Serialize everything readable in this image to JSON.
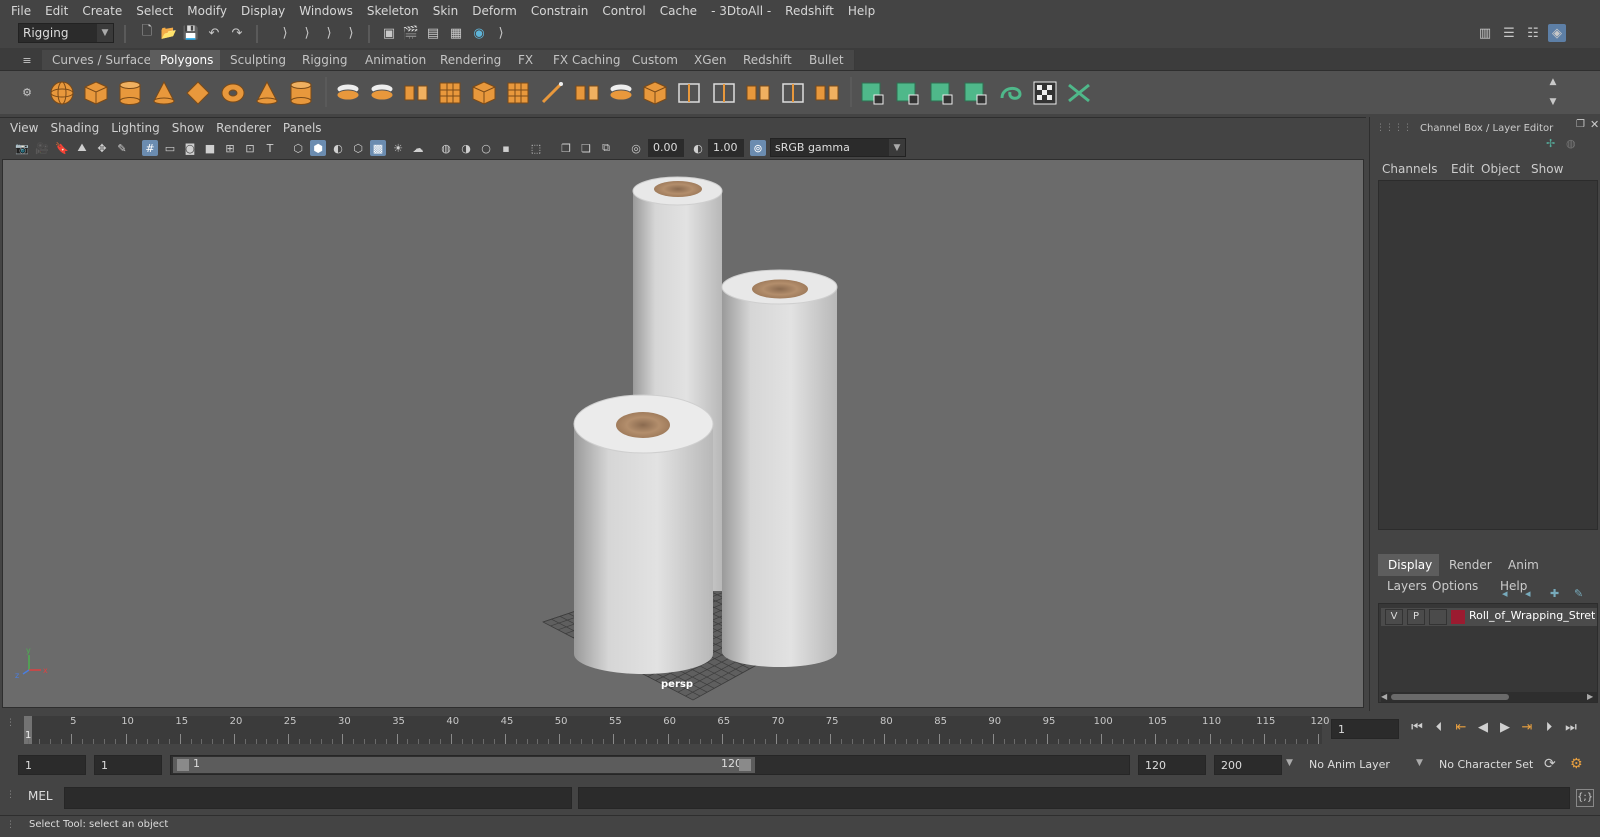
{
  "menubar": [
    "File",
    "Edit",
    "Create",
    "Select",
    "Modify",
    "Display",
    "Windows",
    "Skeleton",
    "Skin",
    "Deform",
    "Constrain",
    "Control",
    "Cache",
    "- 3DtoAll -",
    "Redshift",
    "Help"
  ],
  "statusline": {
    "workspace": "Rigging"
  },
  "shelf_tabs": [
    {
      "label": "Curves / Surfaces",
      "active": false
    },
    {
      "label": "Polygons",
      "active": true
    },
    {
      "label": "Sculpting",
      "active": false
    },
    {
      "label": "Rigging",
      "active": false
    },
    {
      "label": "Animation",
      "active": false
    },
    {
      "label": "Rendering",
      "active": false
    },
    {
      "label": "FX",
      "active": false
    },
    {
      "label": "FX Caching",
      "active": false
    },
    {
      "label": "Custom",
      "active": false
    },
    {
      "label": "XGen",
      "active": false
    },
    {
      "label": "Redshift",
      "active": false
    },
    {
      "label": "Bullet",
      "active": false
    }
  ],
  "viewport": {
    "menus": [
      "View",
      "Shading",
      "Lighting",
      "Show",
      "Renderer",
      "Panels"
    ],
    "exposure": "0.00",
    "gamma": "1.00",
    "color_space": "sRGB gamma",
    "camera_label": "persp"
  },
  "channel_box": {
    "title": "Channel Box / Layer Editor",
    "menus": [
      "Channels",
      "Edit",
      "Object",
      "Show"
    ]
  },
  "layer_editor": {
    "tabs": [
      {
        "label": "Display",
        "active": true
      },
      {
        "label": "Render",
        "active": false
      },
      {
        "label": "Anim",
        "active": false
      }
    ],
    "menus": [
      "Layers",
      "Options",
      "Help"
    ],
    "layer": {
      "v": "V",
      "p": "P",
      "name": "Roll_of_Wrapping_Stretc",
      "color": "#9b1b30"
    }
  },
  "timeline": {
    "ticks": [
      "5",
      "10",
      "15",
      "20",
      "25",
      "30",
      "35",
      "40",
      "45",
      "50",
      "55",
      "60",
      "65",
      "70",
      "75",
      "80",
      "85",
      "90",
      "95",
      "100",
      "105",
      "110",
      "115",
      "120"
    ],
    "start_marker": "1",
    "current_frame": "1"
  },
  "range": {
    "start_field": "1",
    "playback_start": "1",
    "slider_start": "1",
    "slider_end": "120",
    "playback_end": "120",
    "end_field": "200",
    "anim_layer": "No Anim Layer",
    "character_set": "No Character Set"
  },
  "command_line": {
    "label": "MEL"
  },
  "help_line": {
    "text": "Select Tool: select an object"
  }
}
